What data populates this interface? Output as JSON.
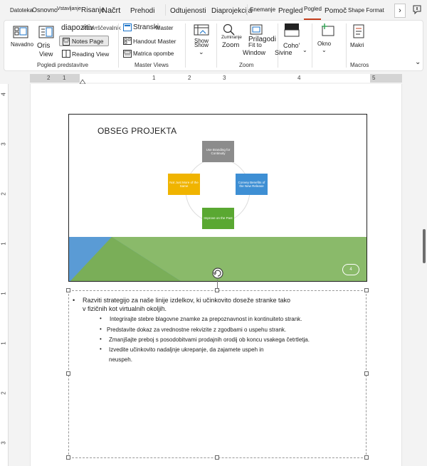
{
  "tabs": [
    {
      "label": "Datoteka",
      "small": true
    },
    {
      "label": "Osnovno",
      "small": true
    },
    {
      "label": "Vstavljanje",
      "small": true
    },
    {
      "label": "Risanje",
      "small": false
    },
    {
      "label": "Načrt",
      "small": false
    },
    {
      "label": "Prehodi",
      "small": false
    },
    {
      "label": "Odtujenosti",
      "small": false
    },
    {
      "label": "Diaprojekcija",
      "small": false
    },
    {
      "label": "Snemanje",
      "small": true
    },
    {
      "label": "Pregled",
      "small": false
    },
    {
      "label": "Pogled",
      "small": true
    },
    {
      "label": "Pomoč",
      "small": false
    },
    {
      "label": "Shape Format",
      "small": true
    }
  ],
  "tab_scroll": "›",
  "ribbon": {
    "presentation_views": {
      "normal": "Navadno",
      "outline_1": "Oris",
      "outline_2": "View",
      "slide_sorter_a": "diapozitiv",
      "slide_sorter_b": "Razvrščevalnik",
      "notes_page": "Notes Page",
      "reading_view": "Reading View",
      "group": "Pogledi predstavitve"
    },
    "master_views": {
      "slide_master_a": "Stranski",
      "slide_master_b": "Master",
      "handout_master": "Handout Master",
      "notes_master": "Matrica opombe",
      "group": "Master Views"
    },
    "show": {
      "label_a": "Show",
      "label_b": "Show",
      "caret": "⌄"
    },
    "zoom": {
      "zoom_small": "Zumiranje",
      "zoom": "Zoom",
      "fit_a": "Prilagodi",
      "fit_b": "Fit to",
      "fit_c": "Window",
      "group": "Zoom"
    },
    "color": {
      "label_a": "Coho'",
      "label_b": "Sivine",
      "caret": "⌄"
    },
    "window": {
      "label": "Okno",
      "caret": "⌄"
    },
    "macros": {
      "label": "Makri",
      "group": "Macros"
    },
    "collapse": "⌄"
  },
  "ruler": {
    "h": [
      "2",
      "1",
      "1",
      "2",
      "3",
      "4",
      "5"
    ],
    "v": [
      "4",
      "3",
      "2",
      "1",
      "1",
      "1",
      "2",
      "3"
    ]
  },
  "slide": {
    "title": "OBSEG PROJEKTA",
    "boxes": {
      "top": "Use Branding for Continuity",
      "right": "Convey Benefits of the New Release",
      "bottom": "Improve on the Past",
      "left": "Not Just More of the Same"
    },
    "number": "4",
    "colors": {
      "top": "#8c8c8c",
      "right": "#3e8fd4",
      "bottom": "#5aa832",
      "left": "#f0b400",
      "green": "#8aba6a",
      "blue": "#5a9bd5"
    }
  },
  "notes": {
    "bullet_symbol": "•",
    "sub_symbol": "•",
    "line1a": "Razviti strategijo za naše linije izdelkov, ki učinkovito doseže stranke tako",
    "line1b": "v fizičnih kot virtualnih okoljih.",
    "sub": [
      "Integrirajte stebre blagovne znamke za prepoznavnost in kontinuiteto strank.",
      "Predstavite dokaz za vrednostne rekvizite z zgodbami o uspehu strank.",
      "Zmanjšajte preboj s posodobitvami prodajnih orodij ob koncu vsakega četrtletja.",
      "Izvedite učinkovito nadaljnje ukrepanje, da zajamete uspeh in"
    ],
    "sub_cont": "neuspeh."
  }
}
